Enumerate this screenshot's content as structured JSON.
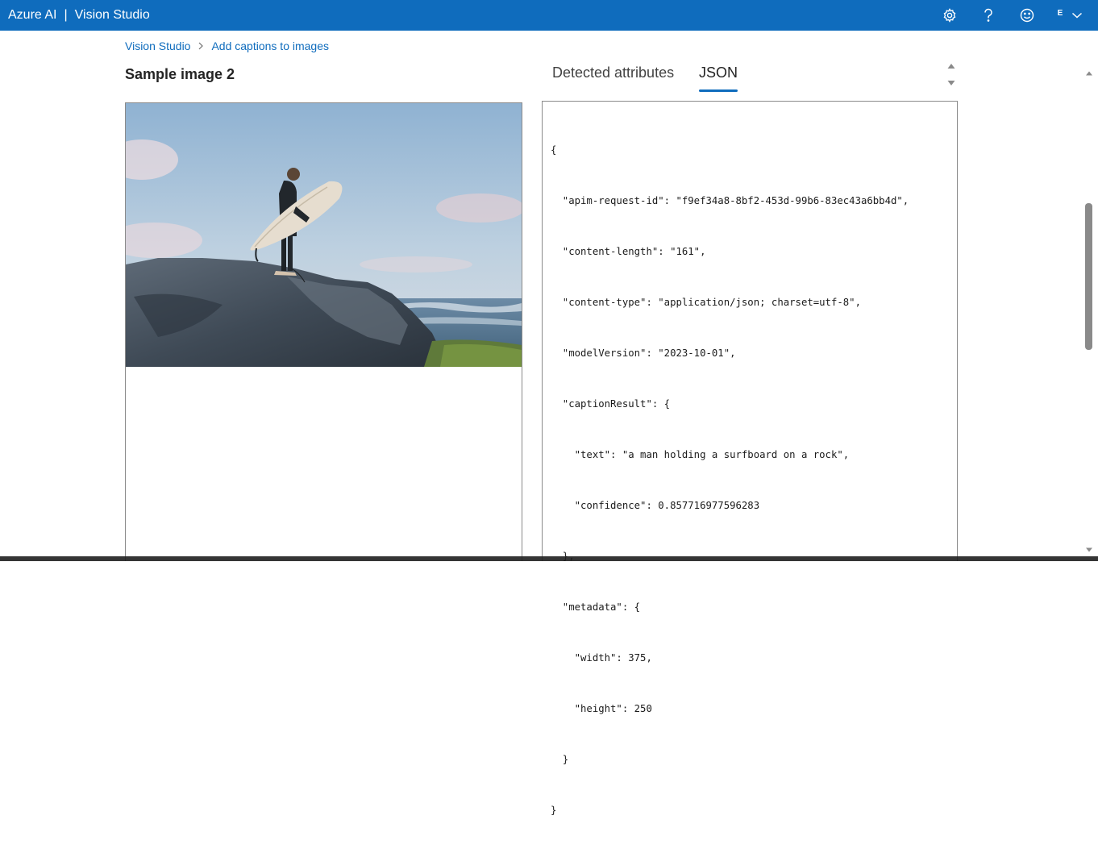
{
  "header": {
    "brand": "Azure AI",
    "separator": "|",
    "product": "Vision Studio",
    "account_initial": "E",
    "icons": [
      "settings-icon",
      "help-icon",
      "feedback-smiley-icon",
      "chevron-down-icon"
    ]
  },
  "breadcrumb": {
    "root": "Vision Studio",
    "current": "Add captions to images"
  },
  "page": {
    "title": "Sample image 2"
  },
  "tabs": [
    {
      "label": "Detected attributes",
      "selected": false
    },
    {
      "label": "JSON",
      "selected": true
    }
  ],
  "json_output": {
    "lines": [
      "{",
      "  \"apim-request-id\": \"f9ef34a8-8bf2-453d-99b6-83ec43a6bb4d\",",
      "  \"content-length\": \"161\",",
      "  \"content-type\": \"application/json; charset=utf-8\",",
      "  \"modelVersion\": \"2023-10-01\",",
      "  \"captionResult\": {",
      "    \"text\": \"a man holding a surfboard on a rock\",",
      "    \"confidence\": 0.857716977596283",
      "  },",
      "  \"metadata\": {",
      "    \"width\": 375,",
      "    \"height\": 250",
      "  }",
      "}"
    ]
  },
  "colors": {
    "topbar": "#0f6cbd",
    "link": "#0f6cbd",
    "tab_underline": "#0f6cbd"
  }
}
